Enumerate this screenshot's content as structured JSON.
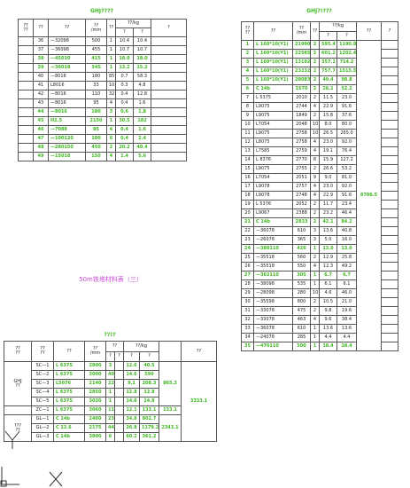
{
  "top_left": {
    "title": "GHJ????",
    "headers": {
      "c1": "??\n??",
      "c2": "??",
      "c3": "??",
      "c4": "??\n/mm",
      "c5": "??",
      "c6": "??/kg",
      "c6a": "?",
      "c6b": "?",
      "c7": "?"
    },
    "rows": [
      {
        "n": "36",
        "spec": "—32098",
        "len": "500",
        "q": "1",
        "w1": "10.4",
        "w2": "10.4",
        "g": false
      },
      {
        "n": "37",
        "spec": "—36098",
        "len": "455",
        "q": "1",
        "w1": "10.7",
        "w2": "10.7",
        "g": false
      },
      {
        "n": "38",
        "spec": "—45010",
        "len": "415",
        "q": "1",
        "w1": "18.0",
        "w2": "18.0",
        "g": true
      },
      {
        "n": "39",
        "spec": "—36018",
        "len": "345",
        "q": "1",
        "w1": "13.2",
        "w2": "15.2",
        "g": true
      },
      {
        "n": "40",
        "spec": "—8016",
        "len": "180",
        "q": "85",
        "w1": "0.7",
        "w2": "58.3",
        "g": false
      },
      {
        "n": "41",
        "spec": "L8016",
        "len": "33",
        "q": "10",
        "w1": "0.3",
        "w2": "4.8",
        "g": false
      },
      {
        "n": "42",
        "spec": "—8016",
        "len": "110",
        "q": "32",
        "w1": "0.4",
        "w2": "12.8",
        "g": false
      },
      {
        "n": "43",
        "spec": "—8016",
        "len": "95",
        "q": "4",
        "w1": "0.4",
        "w2": "1.6",
        "g": false
      },
      {
        "n": "44",
        "spec": "—8016",
        "len": "180",
        "q": "3",
        "w1": "0.6",
        "w2": "1.8",
        "g": true
      },
      {
        "n": "45",
        "spec": "H2.5",
        "len": "2150",
        "q": "1",
        "w1": "30.5",
        "w2": "182",
        "g": true
      },
      {
        "n": "46",
        "spec": "—7088",
        "len": "85",
        "q": "4",
        "w1": "0.4",
        "w2": "1.6",
        "g": true
      },
      {
        "n": "47",
        "spec": "—100120",
        "len": "100",
        "q": "6",
        "w1": "0.4",
        "w2": "2.4",
        "g": true
      },
      {
        "n": "48",
        "spec": "—280150",
        "len": "450",
        "q": "2",
        "w1": "20.2",
        "w2": "40.4",
        "g": true
      },
      {
        "n": "49",
        "spec": "—15018",
        "len": "150",
        "q": "4",
        "w1": "1.4",
        "w2": "5.6",
        "g": true
      }
    ]
  },
  "middle_caption": "50m铁塔材料表（三）",
  "bottom_left": {
    "title": "??!?",
    "headers": {
      "c1": "??\n??",
      "c2": "??\n??",
      "c3": "??",
      "c4": "??\n/mm",
      "c5": "??",
      "c5a": "?",
      "c5b": "?",
      "c6": "??/kg",
      "c6a": "?",
      "c6b": "?",
      "c7": "??"
    },
    "group1_label": "GHJ\n??",
    "group2_label": "???\n??",
    "total": "3333.1",
    "rows": [
      {
        "code": "SC—1",
        "spec": "L 6375",
        "len": "2800",
        "a": "3",
        "b": "",
        "w1": "12.6",
        "w2": "40.5",
        "sub": ""
      },
      {
        "code": "SC—2",
        "spec": "L 6375",
        "len": "3000",
        "a": "40",
        "b": "",
        "w1": "14.6",
        "w2": "590",
        "sub": ""
      },
      {
        "code": "SC—3",
        "spec": "L5076",
        "len": "2140",
        "a": "22",
        "b": "",
        "w1": "9.1",
        "w2": "208.3",
        "sub": "865.3"
      },
      {
        "code": "SC—4",
        "spec": "L 6375",
        "len": "2850",
        "a": "1",
        "b": "",
        "w1": "12.8",
        "w2": "12.8",
        "sub": ""
      },
      {
        "code": "SC—5",
        "spec": "L 6375",
        "len": "3020",
        "a": "1",
        "b": "",
        "w1": "14.8",
        "w2": "14.8",
        "sub": ""
      },
      {
        "code": "ZC—1",
        "spec": "L 6375",
        "len": "3060",
        "a": "11",
        "b": "",
        "w1": "12.1",
        "w2": "133.1",
        "sub": "133.1"
      },
      {
        "code": "GL—1",
        "spec": "C 14b",
        "len": "2400",
        "a": "23",
        "b": "",
        "w1": "34.8",
        "w2": "802.7",
        "sub": ""
      },
      {
        "code": "GL—2",
        "spec": "C 12.6",
        "len": "2175",
        "a": "44",
        "b": "",
        "w1": "26.8",
        "w2": "1179.2",
        "sub": "2343.1"
      },
      {
        "code": "GL—3",
        "spec": "C 14b",
        "len": "3800",
        "a": "6",
        "b": "",
        "w1": "60.2",
        "w2": "361.2",
        "sub": ""
      }
    ]
  },
  "right": {
    "title": "GHJ?!???",
    "headers": {
      "c1": "??\n??",
      "c2": "??",
      "c3": "??\n/mm",
      "c4": "??",
      "c5": "??/kg",
      "c5a": "?",
      "c5b": "?",
      "c6": "??",
      "c7": "?"
    },
    "total": "8706.5",
    "rows": [
      {
        "n": "1",
        "spec": "L 160*10(Y1)",
        "len": "21990",
        "q": "2",
        "w1": "595.4",
        "w2": "1190.8",
        "g": true
      },
      {
        "n": "2",
        "spec": "L 160*10(Y1)",
        "len": "22585",
        "q": "2",
        "w1": "601.2",
        "w2": "1202.4",
        "g": true
      },
      {
        "n": "3",
        "spec": "L 160*10(Y1)",
        "len": "13192",
        "q": "2",
        "w1": "357.1",
        "w2": "714.2",
        "g": true
      },
      {
        "n": "4",
        "spec": "L 160*10(Y1)",
        "len": "23232",
        "q": "2",
        "w1": "757.7",
        "w2": "1515.5",
        "g": true
      },
      {
        "n": "5",
        "spec": "L 160*10(Y1)",
        "len": "28083",
        "q": "2",
        "w1": "49.4",
        "w2": "98.8",
        "g": true
      },
      {
        "n": "6",
        "spec": "C 14b",
        "len": "1570",
        "q": "2",
        "w1": "26.1",
        "w2": "52.2",
        "g": true
      },
      {
        "n": "7",
        "spec": "L 5375",
        "len": "2010",
        "q": "2",
        "w1": "11.5",
        "w2": "23.0",
        "g": false
      },
      {
        "n": "8",
        "spec": "L9075",
        "len": "2744",
        "q": "4",
        "w1": "22.9",
        "w2": "91.6",
        "g": false
      },
      {
        "n": "9",
        "spec": "L9075",
        "len": "1849",
        "q": "2",
        "w1": "15.8",
        "w2": "37.6",
        "g": false
      },
      {
        "n": "10",
        "spec": "L7054",
        "len": "2048",
        "q": "10",
        "w1": "8.0",
        "w2": "80.0",
        "g": false
      },
      {
        "n": "11",
        "spec": "L9075",
        "len": "2758",
        "q": "10",
        "w1": "26.5",
        "w2": "265.0",
        "g": false
      },
      {
        "n": "12",
        "spec": "L8075",
        "len": "2758",
        "q": "4",
        "w1": "23.0",
        "w2": "92.0",
        "g": false
      },
      {
        "n": "13",
        "spec": "L7585",
        "len": "2759",
        "q": "4",
        "w1": "19.1",
        "w2": "76.4",
        "g": false
      },
      {
        "n": "14",
        "spec": "L 8376",
        "len": "2770",
        "q": "8",
        "w1": "15.9",
        "w2": "127.2",
        "g": false
      },
      {
        "n": "15",
        "spec": "L9075",
        "len": "2755",
        "q": "2",
        "w1": "26.6",
        "w2": "53.2",
        "g": false
      },
      {
        "n": "16",
        "spec": "L7054",
        "len": "2051",
        "q": "9",
        "w1": "9.0",
        "w2": "81.0",
        "g": false
      },
      {
        "n": "17",
        "spec": "L9078",
        "len": "2757",
        "q": "4",
        "w1": "23.0",
        "w2": "92.0",
        "g": false
      },
      {
        "n": "18",
        "spec": "L9078",
        "len": "2748",
        "q": "4",
        "w1": "22.9",
        "w2": "91.6",
        "g": false
      },
      {
        "n": "19",
        "spec": "L 5376",
        "len": "2052",
        "q": "2",
        "w1": "11.7",
        "w2": "23.4",
        "g": false
      },
      {
        "n": "20",
        "spec": "L9067",
        "len": "2388",
        "q": "2",
        "w1": "23.2",
        "w2": "46.4",
        "g": false
      },
      {
        "n": "21",
        "spec": "C 14b",
        "len": "2833",
        "q": "2",
        "w1": "42.1",
        "w2": "84.2",
        "g": true
      },
      {
        "n": "22",
        "spec": "—36078",
        "len": "610",
        "q": "3",
        "w1": "13.6",
        "w2": "40.8",
        "g": false
      },
      {
        "n": "23",
        "spec": "—26078",
        "len": "365",
        "q": "3",
        "w1": "5.0",
        "w2": "16.0",
        "g": false
      },
      {
        "n": "24",
        "spec": "—380110",
        "len": "426",
        "q": "1",
        "w1": "13.0",
        "w2": "13.0",
        "g": true
      },
      {
        "n": "25",
        "spec": "—35518",
        "len": "560",
        "q": "2",
        "w1": "12.9",
        "w2": "25.8",
        "g": false
      },
      {
        "n": "26",
        "spec": "—35518",
        "len": "550",
        "q": "4",
        "w1": "12.3",
        "w2": "49.2",
        "g": false
      },
      {
        "n": "27",
        "spec": "—362110",
        "len": "305",
        "q": "1",
        "w1": "6.7",
        "w2": "6.7",
        "g": true
      },
      {
        "n": "28",
        "spec": "—38098",
        "len": "535",
        "q": "1",
        "w1": "6.1",
        "w2": "6.1",
        "g": false
      },
      {
        "n": "29",
        "spec": "—28098",
        "len": "280",
        "q": "10",
        "w1": "4.6",
        "w2": "46.0",
        "g": false
      },
      {
        "n": "30",
        "spec": "—35598",
        "len": "800",
        "q": "2",
        "w1": "10.5",
        "w2": "21.0",
        "g": false
      },
      {
        "n": "31",
        "spec": "—33078",
        "len": "475",
        "q": "2",
        "w1": "9.8",
        "w2": "19.6",
        "g": false
      },
      {
        "n": "32",
        "spec": "—33078",
        "len": "463",
        "q": "4",
        "w1": "9.6",
        "w2": "38.4",
        "g": false
      },
      {
        "n": "33",
        "spec": "—36078",
        "len": "610",
        "q": "1",
        "w1": "13.6",
        "w2": "13.6",
        "g": false
      },
      {
        "n": "34",
        "spec": "—24078",
        "len": "285",
        "q": "1",
        "w1": "4.4",
        "w2": "4.4",
        "g": false
      },
      {
        "n": "35",
        "spec": "—470110",
        "len": "500",
        "q": "1",
        "w1": "18.4",
        "w2": "18.4",
        "g": true
      }
    ]
  }
}
